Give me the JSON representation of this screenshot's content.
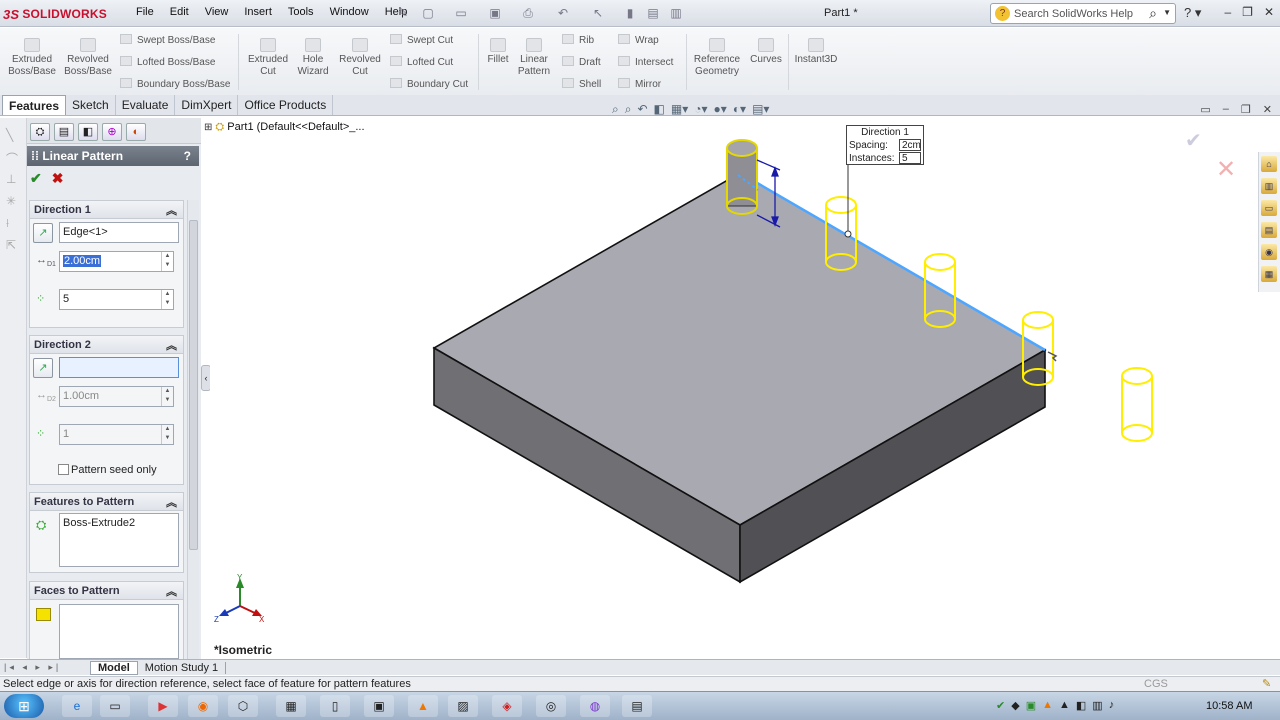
{
  "app": {
    "brand": "SOLIDWORKS",
    "brand_mark": "3S",
    "document_title": "Part1 *"
  },
  "menu": [
    "File",
    "Edit",
    "View",
    "Insert",
    "Tools",
    "Window",
    "Help"
  ],
  "search": {
    "placeholder": "Search SolidWorks Help"
  },
  "help_icon": "?",
  "window_controls": [
    "–",
    "❐",
    "✕"
  ],
  "ribbon": {
    "extruded_boss": "Extruded\nBoss/Base",
    "revolved_boss": "Revolved\nBoss/Base",
    "swept_boss": "Swept Boss/Base",
    "lofted_boss": "Lofted Boss/Base",
    "boundary_boss": "Boundary Boss/Base",
    "extruded_cut": "Extruded\nCut",
    "hole_wizard": "Hole\nWizard",
    "revolved_cut": "Revolved\nCut",
    "swept_cut": "Swept Cut",
    "lofted_cut": "Lofted Cut",
    "boundary_cut": "Boundary Cut",
    "fillet": "Fillet",
    "linear_pattern": "Linear\nPattern",
    "rib": "Rib",
    "draft": "Draft",
    "shell": "Shell",
    "wrap": "Wrap",
    "intersect": "Intersect",
    "mirror": "Mirror",
    "reference_geometry": "Reference\nGeometry",
    "curves": "Curves",
    "instant3d": "Instant3D"
  },
  "tabs": [
    "Features",
    "Sketch",
    "Evaluate",
    "DimXpert",
    "Office Products"
  ],
  "property_manager": {
    "title": "Linear Pattern",
    "help": "?",
    "direction1": {
      "header": "Direction 1",
      "edge": "Edge<1>",
      "spacing": "2.00cm",
      "instances": "5",
      "spacing_tag": "D1"
    },
    "direction2": {
      "header": "Direction 2",
      "edge": "",
      "spacing": "1.00cm",
      "instances": "1",
      "seed_only": "Pattern seed only",
      "spacing_tag": "D2"
    },
    "features": {
      "header": "Features to Pattern",
      "item": "Boss-Extrude2"
    },
    "faces": {
      "header": "Faces to Pattern"
    }
  },
  "feature_tree": {
    "root": "Part1  (Default<<Default>_..."
  },
  "callout": {
    "title": "Direction 1",
    "spacing_label": "Spacing:",
    "spacing_value": "2cm",
    "instances_label": "Instances:",
    "instances_value": "5"
  },
  "view_label": "*Isometric",
  "triad": {
    "y": "Y",
    "z": "Z",
    "x": "X"
  },
  "bottom_tabs": [
    "Model",
    "Motion Study 1"
  ],
  "status": {
    "message": "Select edge or axis for direction reference, select face of feature for pattern features",
    "units": "CGS"
  },
  "clock": "10:58 AM",
  "colors": {
    "accent": "#c8102e",
    "selection_edge": "#4da6ff",
    "preview": "#ffff00",
    "body_top": "#a9a9b1"
  }
}
